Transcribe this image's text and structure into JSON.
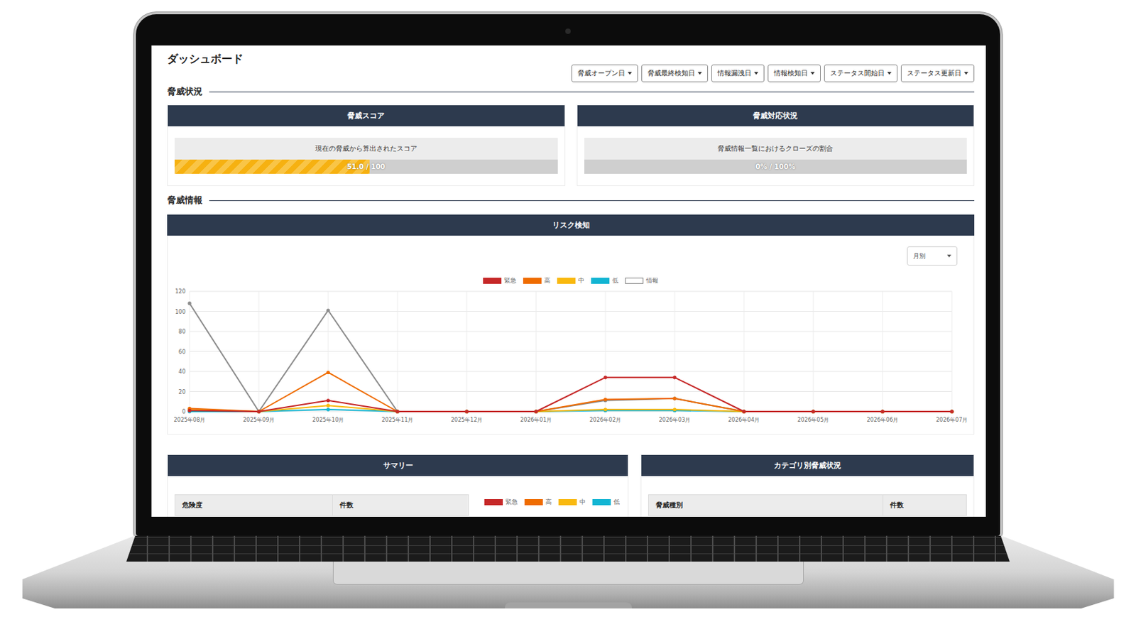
{
  "page_title": "ダッシュボード",
  "filters": [
    "脅威オープン日",
    "脅威最終検知日",
    "情報漏洩日",
    "情報検知日",
    "ステータス開始日",
    "ステータス更新日"
  ],
  "threat_status": {
    "title": "脅威状況",
    "cards": [
      {
        "title": "脅威スコア",
        "caption": "現在の脅威から算出されたスコア",
        "reading": "51.0 / 100",
        "level": 0.51
      },
      {
        "title": "脅威対応状況",
        "caption": "脅威情報一覧におけるクローズの割合",
        "reading": "0% / 100%",
        "level": 0
      }
    ]
  },
  "threat_info": {
    "title": "脅威情報",
    "risk_chart": {
      "title": "リスク検知",
      "period_select": "月別",
      "y_ticks": [
        "0",
        "20",
        "40",
        "60",
        "80",
        "100",
        "120"
      ],
      "x_labels": [
        "2025年08月",
        "2025年09月",
        "2025年10月",
        "2025年11月",
        "2025年12月",
        "2026年01月",
        "2026年02月",
        "2026年03月",
        "2026年04月",
        "2026年05月",
        "2026年06月",
        "2026年07月"
      ],
      "series": [
        {
          "name": "緊急",
          "color": "#c62828",
          "fill": "#c62828",
          "values": [
            1,
            0,
            11,
            0,
            0,
            0,
            34,
            34,
            0,
            0,
            0,
            0
          ]
        },
        {
          "name": "高",
          "color": "#ef6c00",
          "fill": "#ef6c00",
          "values": [
            3,
            0,
            39,
            0,
            0,
            0,
            12,
            13,
            0,
            0,
            0,
            0
          ]
        },
        {
          "name": "中",
          "color": "#f9b90f",
          "fill": "#f9b90f",
          "values": [
            2,
            0,
            6,
            0,
            0,
            0,
            2,
            2,
            0,
            0,
            0,
            0
          ]
        },
        {
          "name": "低",
          "color": "#12b5d3",
          "fill": "#12b5d3",
          "values": [
            0,
            0,
            2,
            0,
            0,
            0,
            1,
            1,
            0,
            0,
            0,
            0
          ]
        },
        {
          "name": "情報",
          "color": "#8c8c8c",
          "fill": "#ffffff",
          "values": [
            108,
            0,
            101,
            0,
            0,
            0,
            11,
            13,
            0,
            0,
            0,
            0
          ]
        }
      ]
    }
  },
  "summary": {
    "title": "サマリー",
    "columns": [
      "危険度",
      "件数"
    ],
    "legend": [
      {
        "name": "緊急",
        "color": "#c62828"
      },
      {
        "name": "高",
        "color": "#ef6c00"
      },
      {
        "name": "中",
        "color": "#f9b90f"
      },
      {
        "name": "低",
        "color": "#12b5d3"
      }
    ]
  },
  "category": {
    "title": "カテゴリ別脅威状況",
    "columns": [
      "脅威種別",
      "件数"
    ]
  }
}
